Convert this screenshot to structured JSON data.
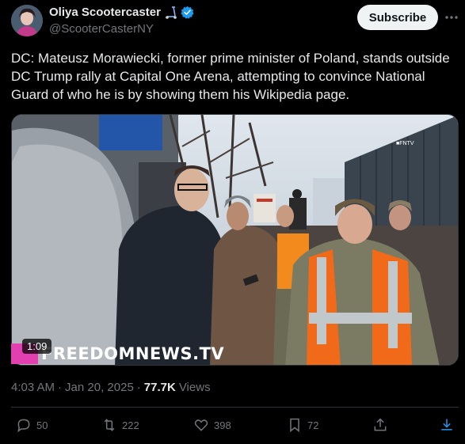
{
  "author": {
    "display_name": "Oliya Scootercaster",
    "handle": "@ScooterCasterNY"
  },
  "subscribe_label": "Subscribe",
  "tweet_text": "DC: Mateusz Morawiecki, former prime minister of Poland, stands outside DC Trump rally at Capital One Arena, attempting to convince National Guard of who he is by showing them his Wikipedia page.",
  "media": {
    "duration": "1:09",
    "watermark": "FREEDOMNEWS.TV",
    "corner_tag": "■FNTV"
  },
  "meta": {
    "time": "4:03 AM",
    "separator": "·",
    "date": "Jan 20, 2025",
    "views_count": "77.7K",
    "views_label": "Views"
  },
  "actions": {
    "replies": "50",
    "reposts": "222",
    "likes": "398",
    "bookmarks": "72"
  },
  "colors": {
    "background": "#000000",
    "primary_text": "#e7e9ea",
    "secondary_text": "#71767b",
    "verified": "#1d9bf0",
    "brand_pink": "#e23fb0"
  }
}
